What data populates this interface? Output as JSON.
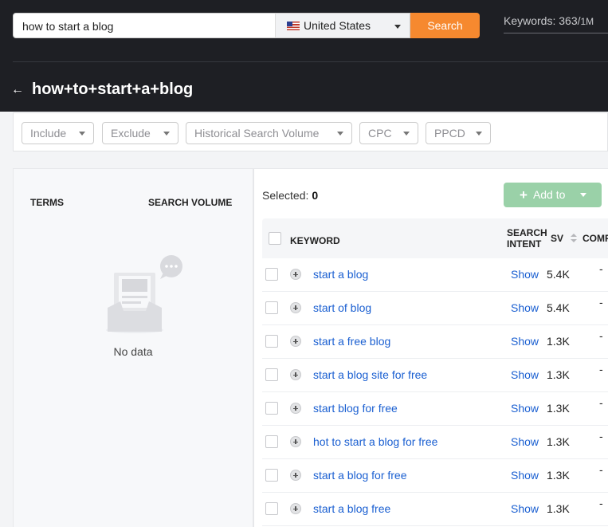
{
  "search": {
    "query": "how to start a blog",
    "country": "United States",
    "button": "Search"
  },
  "keywords_meter": {
    "label": "Keywords: 363/",
    "limit": "1M"
  },
  "page": {
    "back_icon": "arrow-left-icon",
    "title": "how+to+start+a+blog"
  },
  "filters": [
    "Include",
    "Exclude",
    "Historical Search Volume",
    "CPC",
    "PPCD"
  ],
  "left_panel": {
    "col_terms": "TERMS",
    "col_sv": "SEARCH VOLUME",
    "empty_text": "No data"
  },
  "right_panel": {
    "selected_label": "Selected:",
    "selected_count": "0",
    "add_to": "Add to",
    "columns": {
      "keyword": "KEYWORD",
      "intent_1": "SEARCH",
      "intent_2": "INTENT",
      "sv": "SV",
      "comp": "COMP"
    },
    "rows": [
      {
        "keyword": "start a blog",
        "intent": "Show",
        "sv": "5.4K",
        "comp": "-"
      },
      {
        "keyword": "start of blog",
        "intent": "Show",
        "sv": "5.4K",
        "comp": "-"
      },
      {
        "keyword": "start a free blog",
        "intent": "Show",
        "sv": "1.3K",
        "comp": "-"
      },
      {
        "keyword": "start a blog site for free",
        "intent": "Show",
        "sv": "1.3K",
        "comp": "-"
      },
      {
        "keyword": "start blog for free",
        "intent": "Show",
        "sv": "1.3K",
        "comp": "-"
      },
      {
        "keyword": "hot to start a blog for free",
        "intent": "Show",
        "sv": "1.3K",
        "comp": "-"
      },
      {
        "keyword": "start a blog for free",
        "intent": "Show",
        "sv": "1.3K",
        "comp": "-"
      },
      {
        "keyword": "start a blog free",
        "intent": "Show",
        "sv": "1.3K",
        "comp": "-"
      }
    ]
  },
  "colors": {
    "topbar": "#1e1f24",
    "accent_orange": "#f6892f",
    "add_green": "#9ad1a8",
    "link_blue": "#1a5fd1"
  }
}
